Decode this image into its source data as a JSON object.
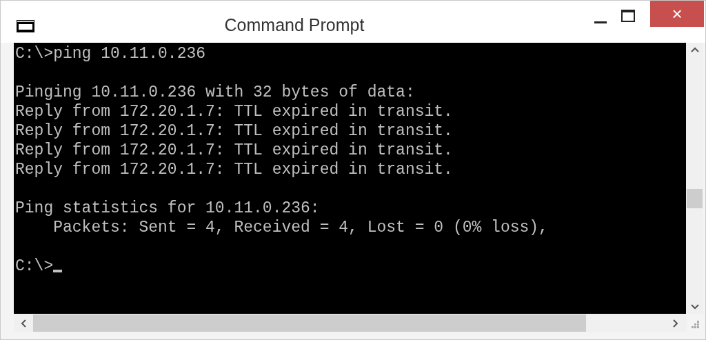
{
  "window": {
    "title": "Command Prompt",
    "close_button": "×"
  },
  "console": {
    "blocks": [
      [
        "C:\\>ping 10.11.0.236"
      ],
      [
        "Pinging 10.11.0.236 with 32 bytes of data:",
        "Reply from 172.20.1.7: TTL expired in transit.",
        "Reply from 172.20.1.7: TTL expired in transit.",
        "Reply from 172.20.1.7: TTL expired in transit.",
        "Reply from 172.20.1.7: TTL expired in transit."
      ],
      [
        "Ping statistics for 10.11.0.236:",
        "    Packets: Sent = 4, Received = 4, Lost = 0 (0% loss),"
      ],
      [
        "C:\\>"
      ]
    ],
    "cursor": true
  }
}
